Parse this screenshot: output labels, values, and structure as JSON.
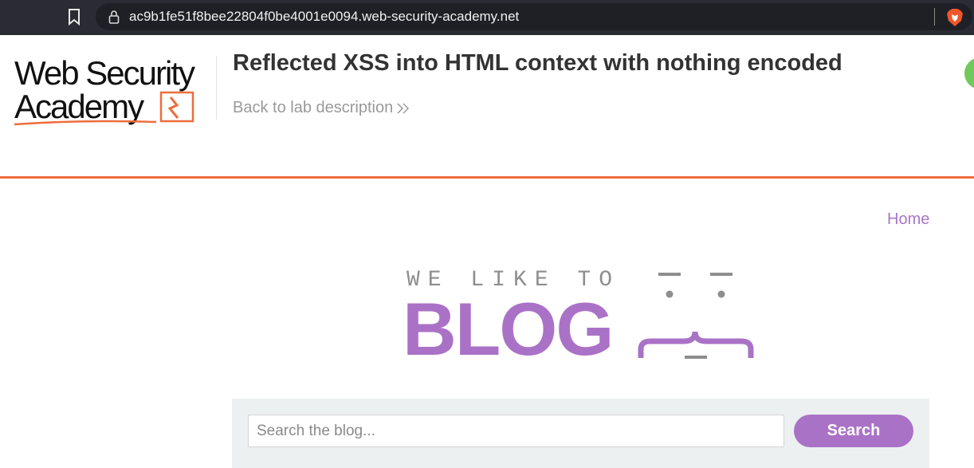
{
  "browser": {
    "url": "ac9b1fe51f8bee22804f0be4001e0094.web-security-academy.net",
    "bookmark_icon": "bookmark-icon",
    "lock_icon": "lock-icon",
    "brave_icon": "brave-lion-icon"
  },
  "lab_header": {
    "logo_text": "Web Security Academy",
    "title": "Reflected XSS into HTML context with nothing encoded",
    "back_link": "Back to lab description",
    "back_chevron_icon": "double-chevron-right-icon",
    "status_indicator": "status-dot"
  },
  "blog": {
    "nav_home": "Home",
    "banner_top": "WE LIKE TO",
    "banner_main": "BLOG",
    "search": {
      "placeholder": "Search the blog...",
      "value": "",
      "button_label": "Search"
    }
  },
  "colors": {
    "browser_bar": "#2b2c33",
    "accent_orange": "#ee6d3c",
    "blog_purple": "#aa72c6",
    "search_panel": "#ecf0f1",
    "status_green": "#70c95a"
  }
}
